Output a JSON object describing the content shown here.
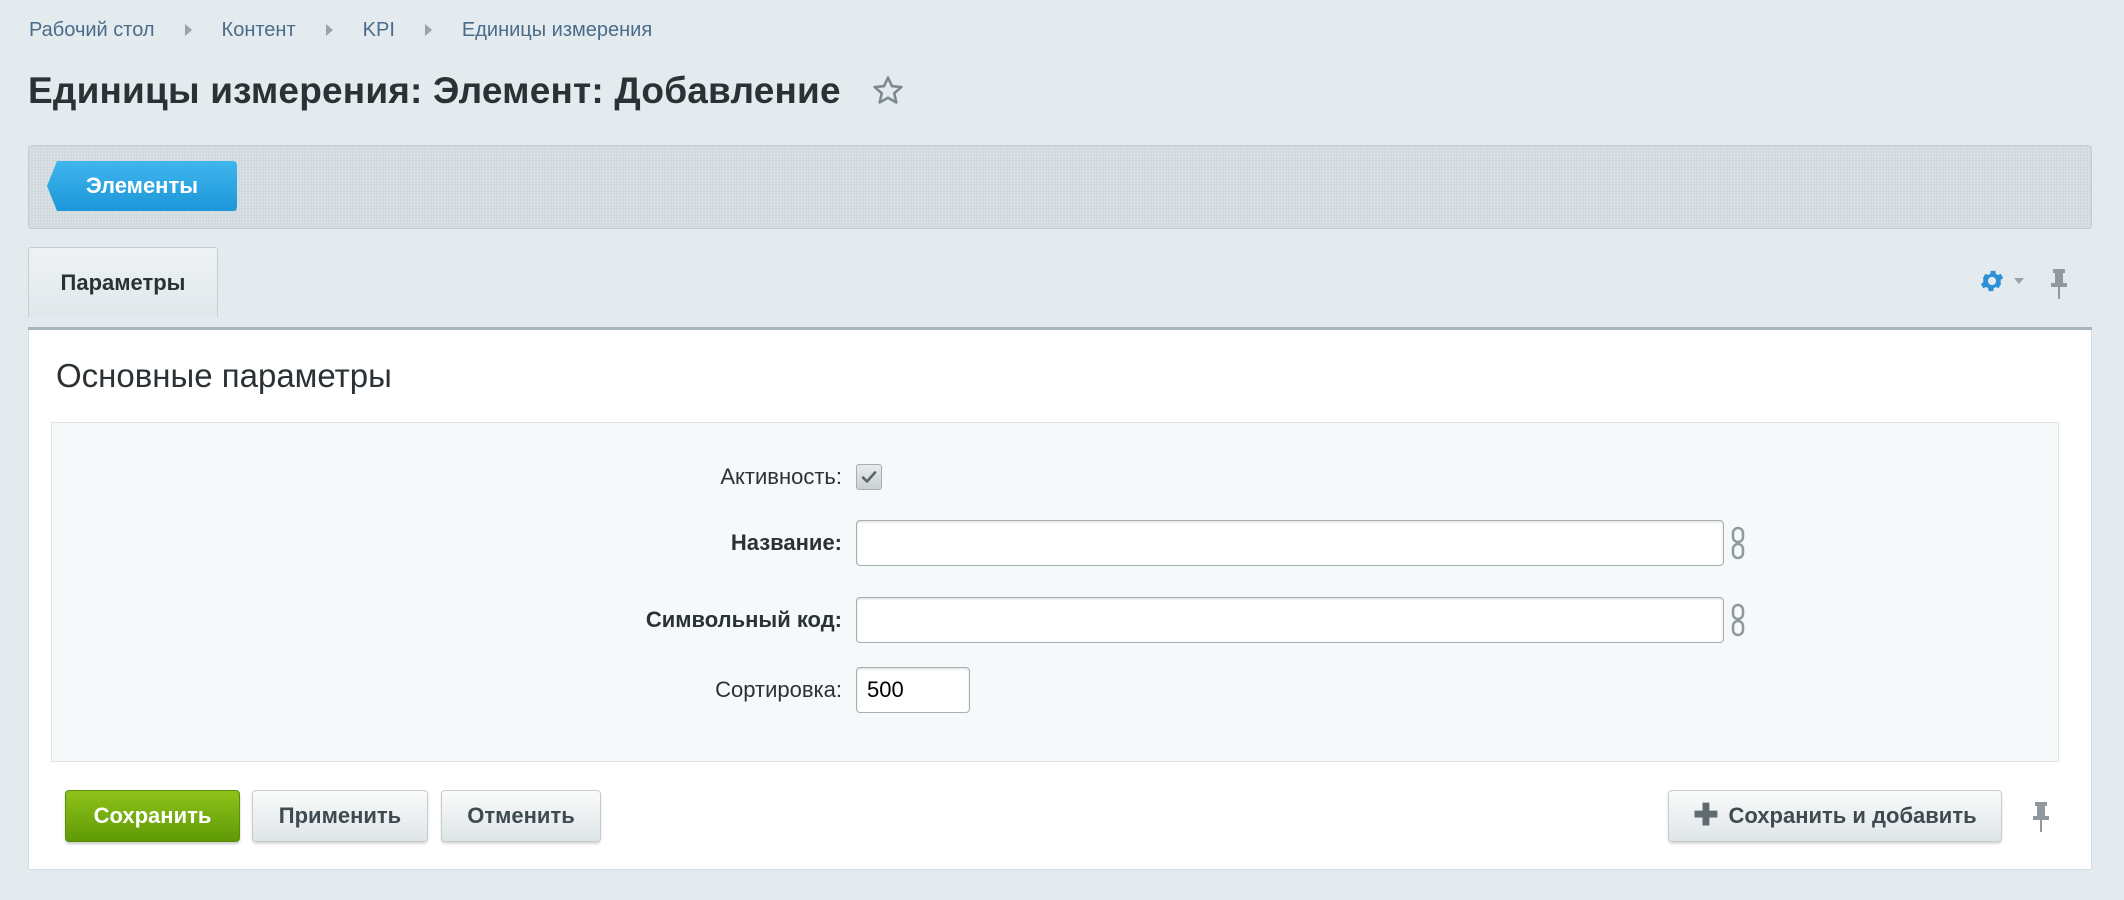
{
  "breadcrumb": [
    "Рабочий стол",
    "Контент",
    "KPI",
    "Единицы измерения"
  ],
  "page": {
    "title": "Единицы измерения: Элемент: Добавление"
  },
  "toolbar": {
    "elements_label": "Элементы"
  },
  "tabs": [
    {
      "label": "Параметры",
      "active": true
    }
  ],
  "section": {
    "title": "Основные параметры"
  },
  "form": {
    "active": {
      "label": "Активность:",
      "checked": true
    },
    "name": {
      "label": "Название:",
      "value": ""
    },
    "code": {
      "label": "Символьный код:",
      "value": ""
    },
    "sort": {
      "label": "Сортировка:",
      "value": "500"
    }
  },
  "buttons": {
    "save": "Сохранить",
    "apply": "Применить",
    "cancel": "Отменить",
    "save_add": "Сохранить и добавить"
  },
  "colors": {
    "accent_blue": "#1c96d9",
    "save_green": "#6aa60c",
    "background": "#e3ebee"
  },
  "icons": [
    "star-icon",
    "gear-icon",
    "pin-icon",
    "link-icon",
    "plus-icon",
    "check-icon"
  ]
}
